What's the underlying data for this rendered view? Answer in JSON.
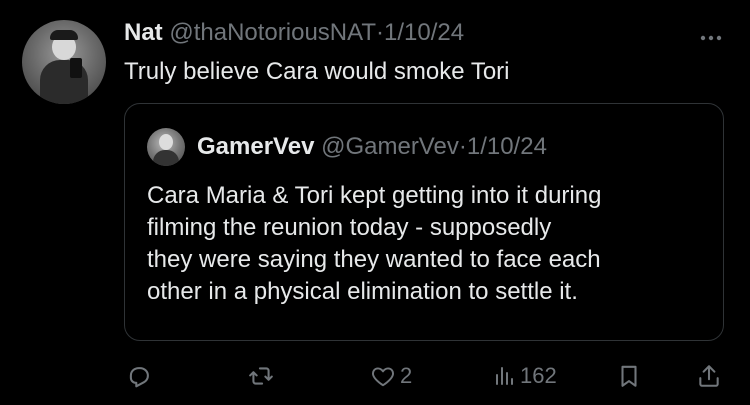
{
  "tweet": {
    "author_name": "Nat",
    "author_handle": "@thaNotoriousNAT",
    "separator": "·",
    "date": "1/10/24",
    "more_icon": "more-horizontal-icon",
    "text": "Truly believe Cara would smoke Tori"
  },
  "quoted_tweet": {
    "author_name": "GamerVev",
    "author_handle": "@GamerVev",
    "separator": "·",
    "date": "1/10/24",
    "lines": [
      "Cara Maria & Tori kept getting into it during",
      "filming the reunion today - supposedly",
      "they were saying they wanted to face each",
      "other in a physical elimination to settle it."
    ]
  },
  "actions": {
    "reply_icon": "reply-icon",
    "retweet_icon": "retweet-icon",
    "like_icon": "heart-icon",
    "like_count": "2",
    "views_icon": "views-chart-icon",
    "views_count": "162",
    "bookmark_icon": "bookmark-icon",
    "share_icon": "share-icon"
  },
  "colors": {
    "background": "#000000",
    "primary_text": "#e7e9ea",
    "secondary_text": "#71767b",
    "border": "#2f3336"
  }
}
